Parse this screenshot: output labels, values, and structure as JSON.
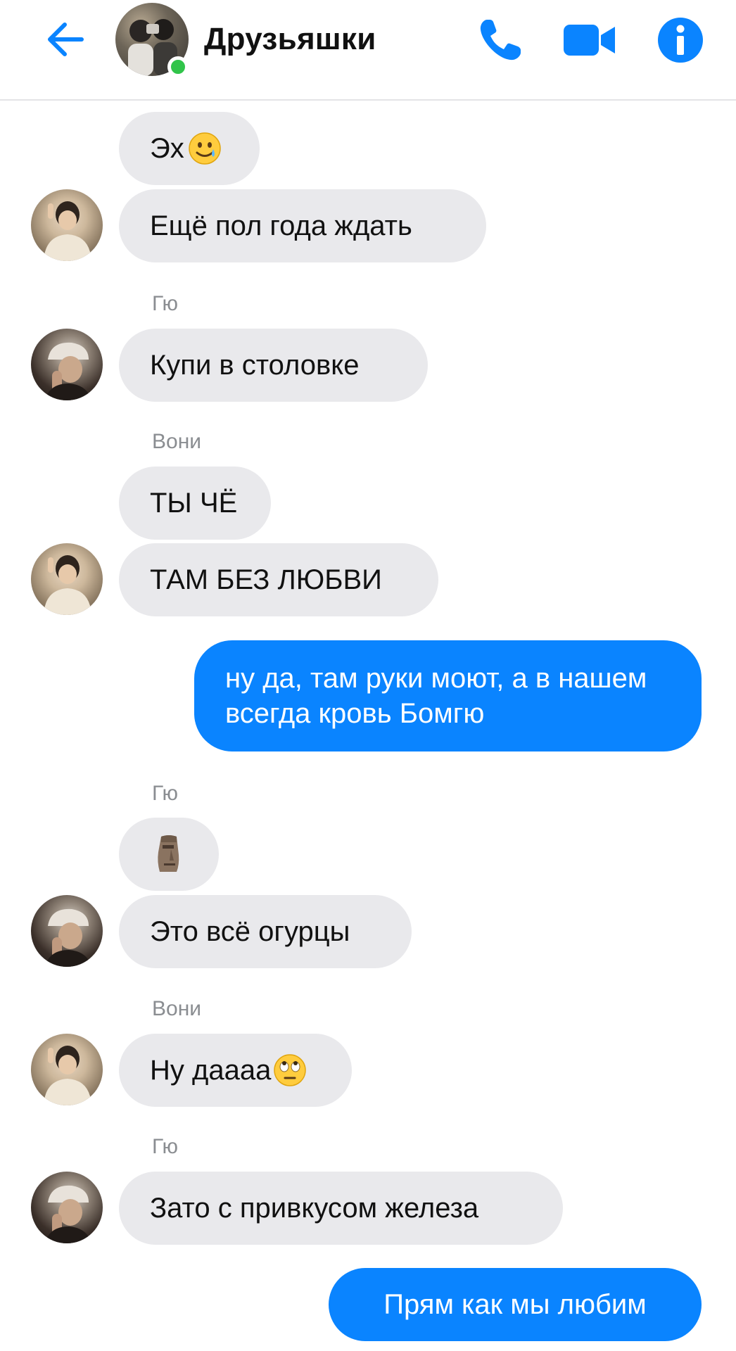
{
  "header": {
    "title": "Друзьяшки",
    "online": true,
    "accent_color": "#0a84ff",
    "online_color": "#31c44a",
    "icons": [
      "back-arrow-icon",
      "phone-icon",
      "video-camera-icon",
      "info-icon"
    ]
  },
  "messages": [
    {
      "sender": "",
      "text": "Эх",
      "emoji": "smiling-face-with-tear",
      "direction": "incoming"
    },
    {
      "sender": "",
      "text": "Ещё пол года ждать",
      "direction": "incoming"
    },
    {
      "sender": "Гю",
      "text": "Купи в столовке",
      "direction": "incoming"
    },
    {
      "sender": "Вони",
      "text": "ТЫ ЧЁ",
      "direction": "incoming"
    },
    {
      "sender": "",
      "text": "ТАМ БЕЗ ЛЮБВИ",
      "direction": "incoming"
    },
    {
      "sender": "",
      "text": "ну да, там руки моют, а в нашем всегда кровь Бомгю",
      "direction": "outgoing"
    },
    {
      "sender": "Гю",
      "text": "",
      "emoji": "moai",
      "direction": "incoming"
    },
    {
      "sender": "",
      "text": "Это всё огурцы",
      "direction": "incoming"
    },
    {
      "sender": "Вони",
      "text": "Ну даааа",
      "emoji": "face-with-rolling-eyes",
      "direction": "incoming"
    },
    {
      "sender": "Гю",
      "text": "Зато с привкусом железа",
      "direction": "incoming"
    },
    {
      "sender": "",
      "text": "Прям как мы любим",
      "direction": "outgoing"
    }
  ],
  "colors": {
    "incoming_bubble": "#e9e9ec",
    "outgoing_bubble": "#0a84ff",
    "sender_label": "#8a8d91"
  }
}
